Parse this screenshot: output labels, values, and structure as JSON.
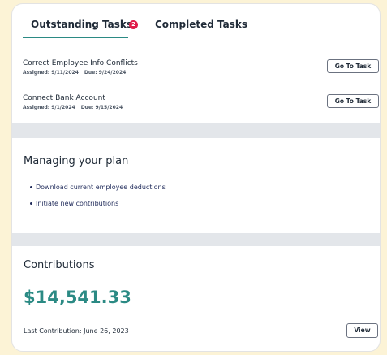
{
  "tabs": {
    "outstanding_label": "Outstanding Tasks",
    "outstanding_count": "2",
    "completed_label": "Completed Tasks"
  },
  "tasks": [
    {
      "name": "Correct Employee Info Conflicts",
      "assigned": "Assigned: 9/11/2024",
      "due": "Due: 9/24/2024",
      "button": "Go To Task"
    },
    {
      "name": "Connect Bank Account",
      "assigned": "Assigned: 9/1/2024",
      "due": "Due: 9/15/2024",
      "button": "Go To Task"
    }
  ],
  "managing": {
    "title": "Managing your plan",
    "links": [
      "Download current employee deductions",
      "Initiate new contributions"
    ]
  },
  "contributions": {
    "title": "Contributions",
    "amount": "$14,541.33",
    "last_contribution": "Last Contribution: June 26, 2023",
    "view_button": "View"
  },
  "colors": {
    "accent": "#2b8a84",
    "badge": "#e01b48",
    "page_background": "#fcf3d6",
    "divider": "#e3e6ea"
  }
}
